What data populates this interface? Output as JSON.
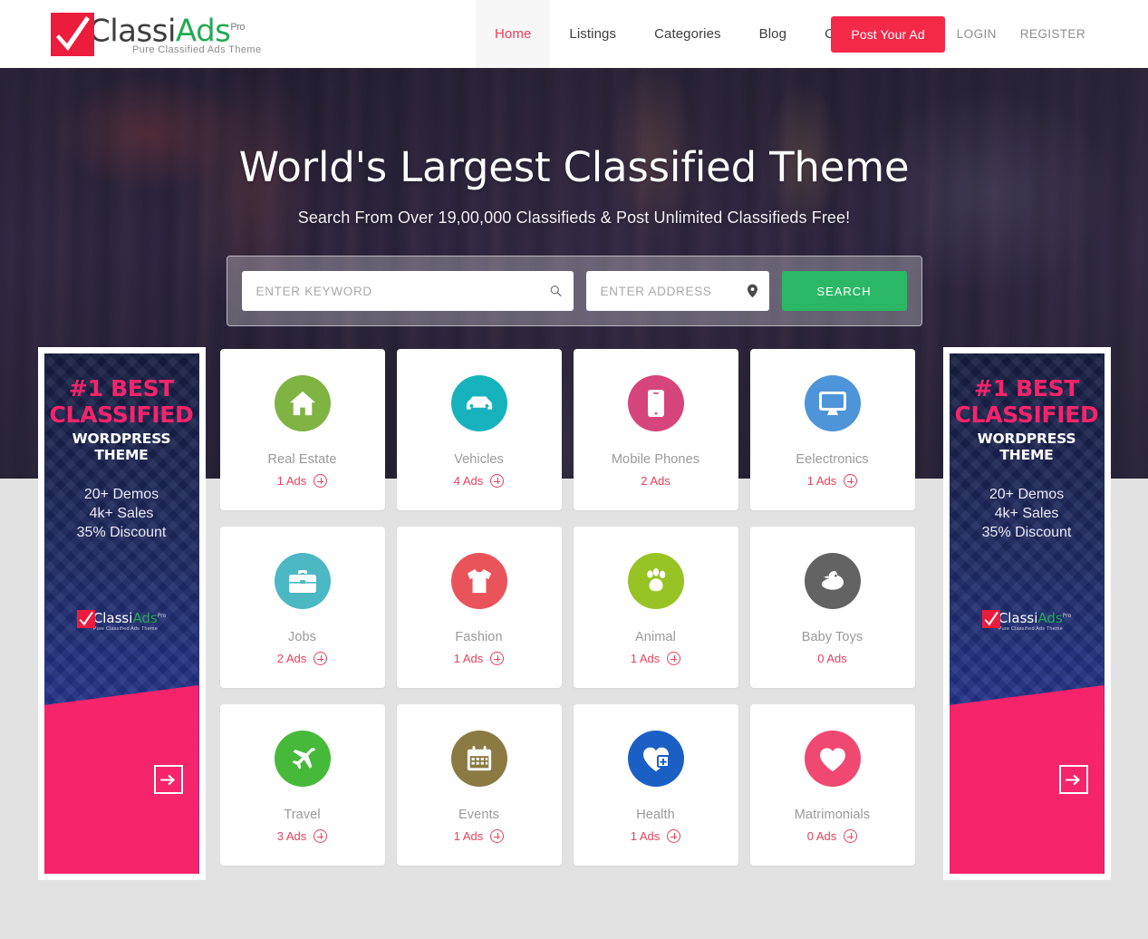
{
  "header": {
    "logo": {
      "mark_icon": "checkmark-icon",
      "text_primary": "Classi",
      "text_secondary": "Ads",
      "badge": "Pro",
      "tagline": "Pure Classified Ads Theme",
      "mark_color": "#ec1c3d",
      "secondary_color": "#22ab52"
    },
    "nav": [
      {
        "label": "Home",
        "active": true
      },
      {
        "label": "Listings",
        "active": false
      },
      {
        "label": "Categories",
        "active": false
      },
      {
        "label": "Blog",
        "active": false
      },
      {
        "label": "Contact",
        "active": false
      }
    ],
    "post_ad_label": "Post Your Ad",
    "post_ad_color": "#f42847",
    "login_label": "LOGIN",
    "register_label": "REGISTER"
  },
  "hero": {
    "title": "World's Largest Classified Theme",
    "subtitle": "Search From Over 19,00,000 Classifieds & Post Unlimited Classifieds Free!",
    "search": {
      "keyword_placeholder": "ENTER KEYWORD",
      "keyword_value": "",
      "keyword_icon": "search-icon",
      "address_placeholder": "ENTER ADDRESS",
      "address_value": "",
      "address_icon": "map-pin-icon",
      "button_label": "SEARCH",
      "button_color": "#2ab866"
    }
  },
  "ad_banner": {
    "line1": "#1 BEST",
    "line2": "CLASSIFIED",
    "line3": "WORDPRESS THEME",
    "stat1": "20+ Demos",
    "stat2": "4k+ Sales",
    "stat3": "35% Discount",
    "logo_primary": "Classi",
    "logo_secondary": "Ads",
    "logo_badge": "Pro",
    "logo_tagline": "Pure Classified Ads Theme",
    "accent_color": "#f5246b",
    "arrow_icon": "arrow-right-icon"
  },
  "categories": [
    {
      "name": "Real Estate",
      "count": "1 Ads",
      "has_plus": true,
      "icon": "home-icon",
      "color": "#7fb342"
    },
    {
      "name": "Vehicles",
      "count": "4 Ads",
      "has_plus": true,
      "icon": "car-icon",
      "color": "#17b3bd"
    },
    {
      "name": "Mobile Phones",
      "count": "2 Ads",
      "has_plus": false,
      "icon": "phone-icon",
      "color": "#d6457c"
    },
    {
      "name": "Eelectronics",
      "count": "1 Ads",
      "has_plus": true,
      "icon": "monitor-icon",
      "color": "#4e94d8"
    },
    {
      "name": "Jobs",
      "count": "2 Ads",
      "has_plus": true,
      "icon": "briefcase-icon",
      "color": "#4bb8c4"
    },
    {
      "name": "Fashion",
      "count": "1 Ads",
      "has_plus": true,
      "icon": "tshirt-icon",
      "color": "#e9535a"
    },
    {
      "name": "Animal",
      "count": "1 Ads",
      "has_plus": true,
      "icon": "paw-icon",
      "color": "#97c424"
    },
    {
      "name": "Baby Toys",
      "count": "0 Ads",
      "has_plus": false,
      "icon": "duck-icon",
      "color": "#636363"
    },
    {
      "name": "Travel",
      "count": "3 Ads",
      "has_plus": true,
      "icon": "airplane-icon",
      "color": "#46b93a"
    },
    {
      "name": "Events",
      "count": "1 Ads",
      "has_plus": true,
      "icon": "calendar-icon",
      "color": "#8b7a42"
    },
    {
      "name": "Health",
      "count": "1 Ads",
      "has_plus": true,
      "icon": "heart-plus-icon",
      "color": "#1a5fc4"
    },
    {
      "name": "Matrimonials",
      "count": "0 Ads",
      "has_plus": true,
      "icon": "heart-icon",
      "color": "#ef4871"
    }
  ]
}
